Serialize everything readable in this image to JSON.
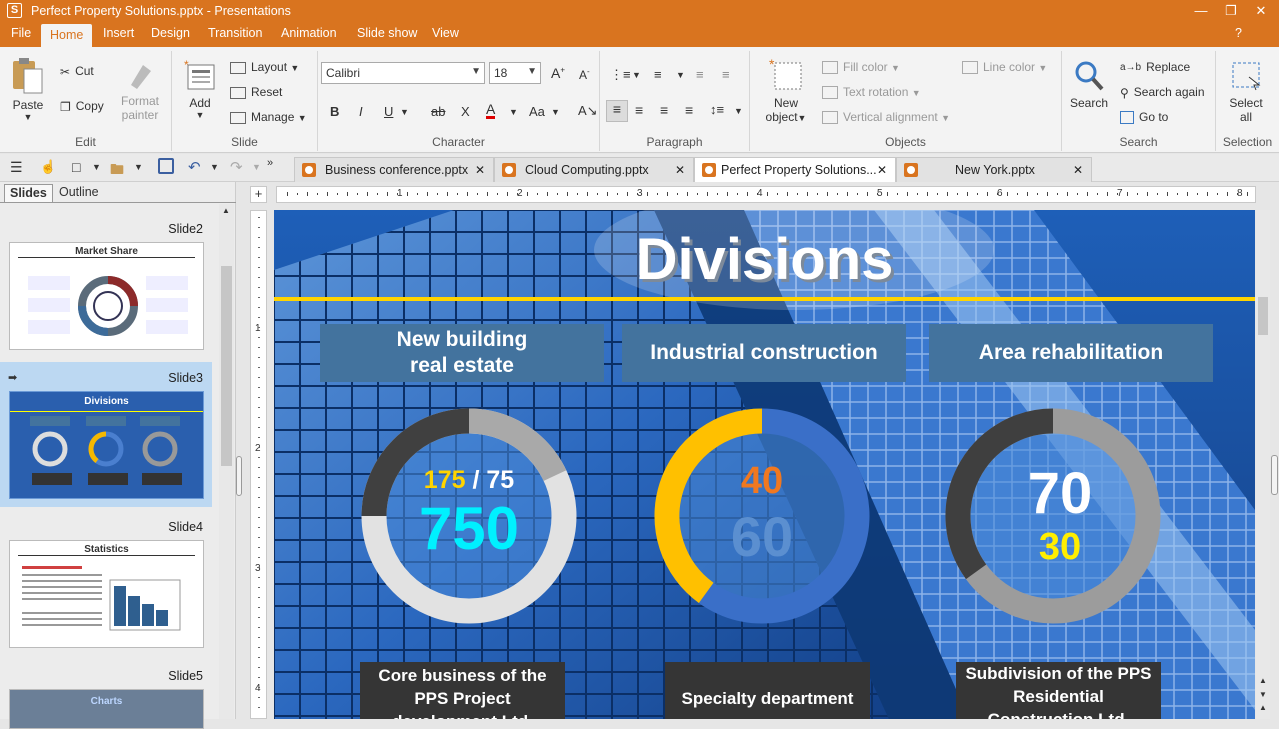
{
  "window": {
    "title": "Perfect Property Solutions.pptx - Presentations",
    "app_icon": "S"
  },
  "menu": [
    "File",
    "Home",
    "Insert",
    "Design",
    "Transition",
    "Animation",
    "Slide show",
    "View"
  ],
  "menu_active": "Home",
  "help": "?",
  "ribbon": {
    "edit": {
      "label": "Edit",
      "paste": "Paste",
      "cut": "Cut",
      "copy": "Copy",
      "format_painter_1": "Format",
      "format_painter_2": "painter"
    },
    "slide": {
      "label": "Slide",
      "add": "Add",
      "layout": "Layout",
      "reset": "Reset",
      "manage": "Manage"
    },
    "character": {
      "label": "Character",
      "font": "Calibri",
      "size": "18"
    },
    "paragraph": {
      "label": "Paragraph"
    },
    "objects": {
      "label": "Objects",
      "new_object_1": "New",
      "new_object_2": "object",
      "fill_color": "Fill color",
      "text_rotation": "Text rotation",
      "vertical_alignment": "Vertical alignment",
      "line_color": "Line color"
    },
    "search": {
      "label": "Search",
      "search": "Search",
      "replace": "Replace",
      "search_again": "Search again",
      "go_to": "Go to"
    },
    "selection": {
      "label": "Selection",
      "select_all_1": "Select",
      "select_all_2": "all"
    }
  },
  "tabs": [
    {
      "label": "Business conference.pptx",
      "active": false
    },
    {
      "label": "Cloud Computing.pptx",
      "active": false
    },
    {
      "label": "Perfect Property Solutions...",
      "active": true
    },
    {
      "label": "New York.pptx",
      "active": false
    }
  ],
  "sidepanel": {
    "tab_slides": "Slides",
    "tab_outline": "Outline",
    "slide2": "Slide2",
    "slide3": "Slide3",
    "slide4": "Slide4",
    "slide5": "Slide5",
    "thumb2_title": "Market Share",
    "thumb3_title": "Divisions",
    "thumb4_title": "Statistics",
    "thumb5_title": "Charts"
  },
  "ruler_numbers": [
    "1",
    "2",
    "3",
    "4",
    "5",
    "6",
    "7",
    "8"
  ],
  "ruler_v_numbers": [
    "1",
    "2",
    "3",
    "4"
  ],
  "slide": {
    "title": "Divisions",
    "headers": [
      {
        "line1": "New building",
        "line2": "real estate"
      },
      {
        "line1": "Industrial construction",
        "line2": ""
      },
      {
        "line1": "Area rehabilitation",
        "line2": ""
      }
    ],
    "donut1": {
      "small_a": "175",
      "sep": "/",
      "small_b": "75",
      "big": "750",
      "fraction": 0.18
    },
    "donut2": {
      "top": "40",
      "bottom": "60",
      "fraction": 0.4
    },
    "donut3": {
      "top": "70",
      "bottom": "30",
      "fraction": 0.3
    },
    "bottoms": [
      {
        "line1": "Core business of the",
        "line2": "PPS Project",
        "line3": "development Ltd."
      },
      {
        "line1": "Specialty department",
        "line2": "",
        "line3": ""
      },
      {
        "line1": "Subdivision of the PPS",
        "line2": "Residential",
        "line3": "Construction Ltd."
      }
    ]
  },
  "colors": {
    "accent": "#d9741f",
    "slide_header": "#43739e",
    "yellow": "#ffd400",
    "cyan": "#00f0ff",
    "orange_num": "#f07820",
    "blue_num": "#5b8fd0"
  }
}
